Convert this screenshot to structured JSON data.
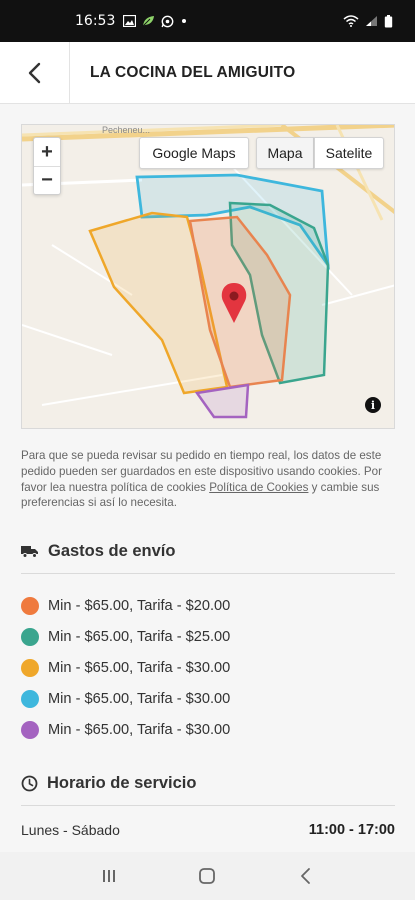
{
  "status_bar": {
    "time": "16:53",
    "left_icons": [
      "image-icon",
      "leaf-icon",
      "whatsapp-icon",
      "dot-icon"
    ],
    "right_icons": [
      "wifi-icon",
      "signal-icon",
      "battery-icon"
    ]
  },
  "header": {
    "title": "LA COCINA DEL AMIGUITO",
    "back_icon": "chevron-left-icon"
  },
  "map": {
    "zoom_in": "+",
    "zoom_out": "−",
    "google_maps_label": "Google Maps",
    "map_type_map": "Mapa",
    "map_type_satellite": "Satelite",
    "selected_map_type": "Mapa",
    "info_label": "i",
    "street_label": "Pecheneu...",
    "marker_color": "#e3353f",
    "zone_colors": [
      "#e8844f",
      "#3aa58e",
      "#efa72a",
      "#3eb7dd",
      "#a463c0"
    ]
  },
  "cookie_notice": {
    "text_before": "Para que se pueda revisar su pedido en tiempo real, los datos de este pedido pueden ser guardados en este dispositivo usando cookies. Por favor lea nuestra política de cookies ",
    "link_text": "Política de Cookies",
    "text_after": " y cambie sus preferencias si así lo necesita."
  },
  "shipping": {
    "title": "Gastos de envío",
    "icon": "truck-icon",
    "fees": [
      {
        "label": "Min - $65.00, Tarifa - $20.00",
        "color": "#ef7a3e"
      },
      {
        "label": "Min - $65.00, Tarifa - $25.00",
        "color": "#3aa58e"
      },
      {
        "label": "Min - $65.00, Tarifa - $30.00",
        "color": "#efa72a"
      },
      {
        "label": "Min - $65.00, Tarifa - $30.00",
        "color": "#3eb7dd"
      },
      {
        "label": "Min - $65.00, Tarifa - $30.00",
        "color": "#a463c0"
      }
    ]
  },
  "schedule": {
    "title": "Horario de servicio",
    "icon": "clock-icon",
    "days": "Lunes - Sábado",
    "hours": "11:00 - 17:00"
  },
  "nav_bar": {
    "icons": [
      "recent-apps-icon",
      "home-icon",
      "back-icon"
    ]
  }
}
